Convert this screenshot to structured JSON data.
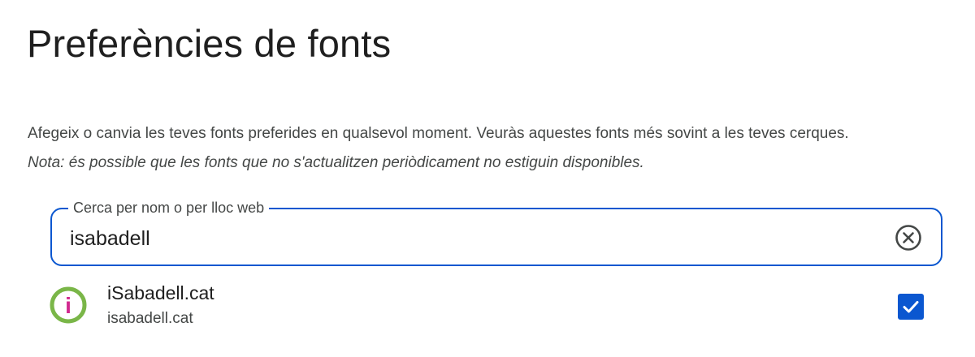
{
  "page": {
    "title": "Preferències de fonts",
    "description": "Afegeix o canvia les teves fonts preferides en qualsevol moment. Veuràs aquestes fonts més sovint a les teves cerques.",
    "note": "Nota: és possible que les fonts que no s'actualitzen periòdicament no estiguin disponibles."
  },
  "search": {
    "label": "Cerca per nom o per lloc web",
    "value": "isabadell",
    "clear_icon": "close-circle-icon"
  },
  "results": [
    {
      "name": "iSabadell.cat",
      "url": "isabadell.cat",
      "logo_letter": "i",
      "checked": true
    }
  ],
  "colors": {
    "accent": "#0b57d0",
    "logo_ring": "#7ab648",
    "logo_letter": "#d1288f"
  }
}
